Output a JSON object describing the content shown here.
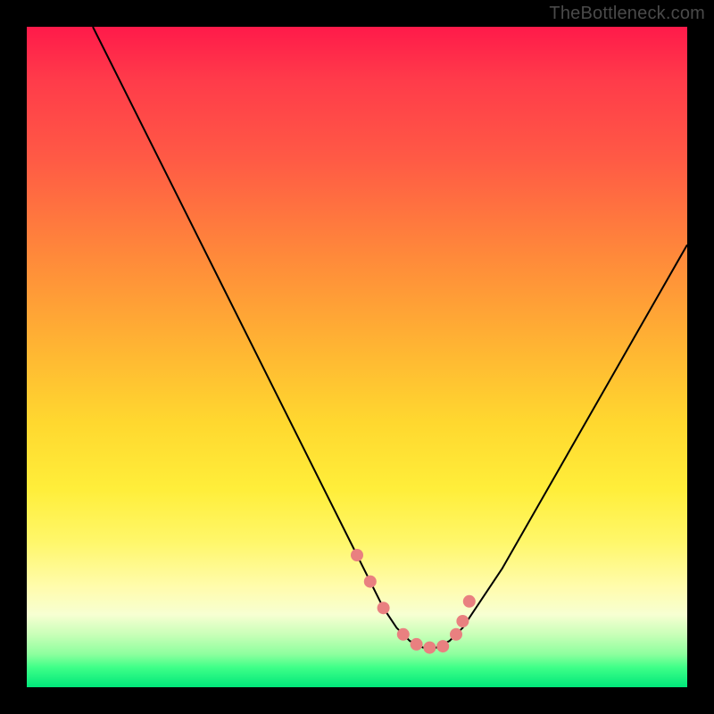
{
  "watermark": "TheBottleneck.com",
  "colors": {
    "frame": "#000000",
    "curve": "#000000",
    "dot": "#e98080",
    "gradient_top": "#ff1a4a",
    "gradient_bottom": "#00e77a"
  },
  "chart_data": {
    "type": "line",
    "title": "",
    "xlabel": "",
    "ylabel": "",
    "xlim": [
      0,
      100
    ],
    "ylim": [
      0,
      100
    ],
    "note": "Axes are unlabeled in the source image; values are estimated on a 0–100 normalized scale where y is bottleneck magnitude (lower = better). The curve is a V-shaped valley; pink dots mark points near the minimum.",
    "series": [
      {
        "name": "bottleneck-curve",
        "x": [
          10,
          14,
          18,
          22,
          26,
          30,
          34,
          38,
          42,
          46,
          50,
          52,
          54,
          56,
          58,
          60,
          62,
          64,
          66,
          68,
          72,
          76,
          80,
          84,
          88,
          92,
          96,
          100
        ],
        "y": [
          100,
          92,
          84,
          76,
          68,
          60,
          52,
          44,
          36,
          28,
          20,
          16,
          12,
          9,
          7,
          6,
          6,
          7,
          9,
          12,
          18,
          25,
          32,
          39,
          46,
          53,
          60,
          67
        ]
      }
    ],
    "dots": {
      "name": "highlighted-points",
      "x": [
        50,
        52,
        54,
        57,
        59,
        61,
        63,
        65,
        66,
        67
      ],
      "y": [
        20,
        16,
        12,
        8,
        6.5,
        6,
        6.2,
        8,
        10,
        13
      ]
    }
  }
}
